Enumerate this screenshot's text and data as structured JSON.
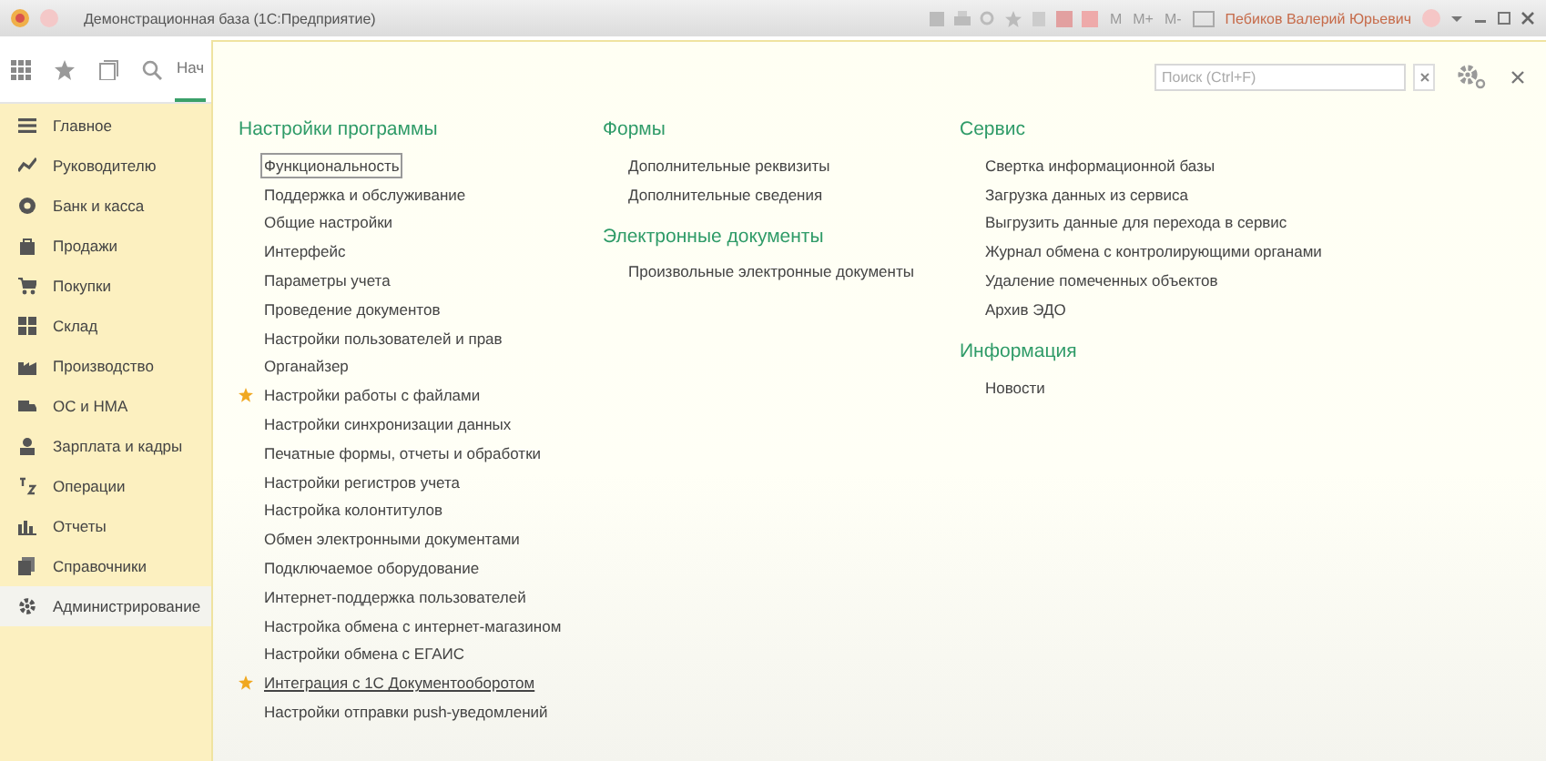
{
  "window": {
    "title": "Демонстрационная база  (1С:Предприятие)",
    "memory_buttons": [
      "M",
      "M+",
      "M-"
    ],
    "user": "Пебиков Валерий Юрьевич"
  },
  "nav_tabs": [
    {
      "label": "Нач",
      "selected": true
    }
  ],
  "sidebar": {
    "items": [
      {
        "label": "Главное",
        "selected": false
      },
      {
        "label": "Руководителю",
        "selected": false
      },
      {
        "label": "Банк и касса",
        "selected": false
      },
      {
        "label": "Продажи",
        "selected": false
      },
      {
        "label": "Покупки",
        "selected": false
      },
      {
        "label": "Склад",
        "selected": false
      },
      {
        "label": "Производство",
        "selected": false
      },
      {
        "label": "ОС и НМА",
        "selected": false
      },
      {
        "label": "Зарплата и кадры",
        "selected": false
      },
      {
        "label": "Операции",
        "selected": false
      },
      {
        "label": "Отчеты",
        "selected": false
      },
      {
        "label": "Справочники",
        "selected": false
      },
      {
        "label": "Администрирование",
        "selected": true
      }
    ]
  },
  "panel": {
    "search": {
      "placeholder": "Поиск (Ctrl+F)"
    },
    "columns": [
      {
        "sections": [
          {
            "title": "Настройки программы",
            "items": [
              {
                "label": "Функциональность",
                "starred": false,
                "focused": true,
                "hovered": false
              },
              {
                "label": "Поддержка и обслуживание",
                "starred": false,
                "focused": false,
                "hovered": false
              },
              {
                "label": "Общие настройки",
                "starred": false,
                "focused": false,
                "hovered": false
              },
              {
                "label": "Интерфейс",
                "starred": false,
                "focused": false,
                "hovered": false
              },
              {
                "label": "Параметры учета",
                "starred": false,
                "focused": false,
                "hovered": false
              },
              {
                "label": "Проведение документов",
                "starred": false,
                "focused": false,
                "hovered": false
              },
              {
                "label": "Настройки пользователей и прав",
                "starred": false,
                "focused": false,
                "hovered": false
              },
              {
                "label": "Органайзер",
                "starred": false,
                "focused": false,
                "hovered": false
              },
              {
                "label": "Настройки работы с файлами",
                "starred": true,
                "focused": false,
                "hovered": false
              },
              {
                "label": "Настройки синхронизации данных",
                "starred": false,
                "focused": false,
                "hovered": false
              },
              {
                "label": "Печатные формы, отчеты и обработки",
                "starred": false,
                "focused": false,
                "hovered": false
              },
              {
                "label": "Настройки регистров учета",
                "starred": false,
                "focused": false,
                "hovered": false
              },
              {
                "label": "Настройка колонтитулов",
                "starred": false,
                "focused": false,
                "hovered": false
              },
              {
                "label": "Обмен электронными документами",
                "starred": false,
                "focused": false,
                "hovered": false
              },
              {
                "label": "Подключаемое оборудование",
                "starred": false,
                "focused": false,
                "hovered": false
              },
              {
                "label": "Интернет-поддержка пользователей",
                "starred": false,
                "focused": false,
                "hovered": false
              },
              {
                "label": "Настройка обмена с интернет-магазином",
                "starred": false,
                "focused": false,
                "hovered": false
              },
              {
                "label": "Настройки обмена с ЕГАИС",
                "starred": false,
                "focused": false,
                "hovered": false
              },
              {
                "label": "Интеграция с 1С Документооборотом",
                "starred": true,
                "focused": false,
                "hovered": true
              },
              {
                "label": "Настройки отправки push-уведомлений",
                "starred": false,
                "focused": false,
                "hovered": false
              }
            ]
          }
        ]
      },
      {
        "sections": [
          {
            "title": "Формы",
            "items": [
              {
                "label": "Дополнительные реквизиты",
                "starred": false,
                "focused": false,
                "hovered": false
              },
              {
                "label": "Дополнительные сведения",
                "starred": false,
                "focused": false,
                "hovered": false
              }
            ]
          },
          {
            "title": "Электронные документы",
            "items": [
              {
                "label": "Произвольные электронные документы",
                "starred": false,
                "focused": false,
                "hovered": false
              }
            ]
          }
        ]
      },
      {
        "sections": [
          {
            "title": "Сервис",
            "items": [
              {
                "label": "Свертка информационной базы",
                "starred": false,
                "focused": false,
                "hovered": false
              },
              {
                "label": "Загрузка данных из сервиса",
                "starred": false,
                "focused": false,
                "hovered": false
              },
              {
                "label": "Выгрузить данные для перехода в сервис",
                "starred": false,
                "focused": false,
                "hovered": false
              },
              {
                "label": "Журнал обмена с контролирующими органами",
                "starred": false,
                "focused": false,
                "hovered": false
              },
              {
                "label": "Удаление помеченных объектов",
                "starred": false,
                "focused": false,
                "hovered": false
              },
              {
                "label": "Архив ЭДО",
                "starred": false,
                "focused": false,
                "hovered": false
              }
            ]
          },
          {
            "title": "Информация",
            "items": [
              {
                "label": "Новости",
                "starred": false,
                "focused": false,
                "hovered": false
              }
            ]
          }
        ]
      }
    ]
  }
}
